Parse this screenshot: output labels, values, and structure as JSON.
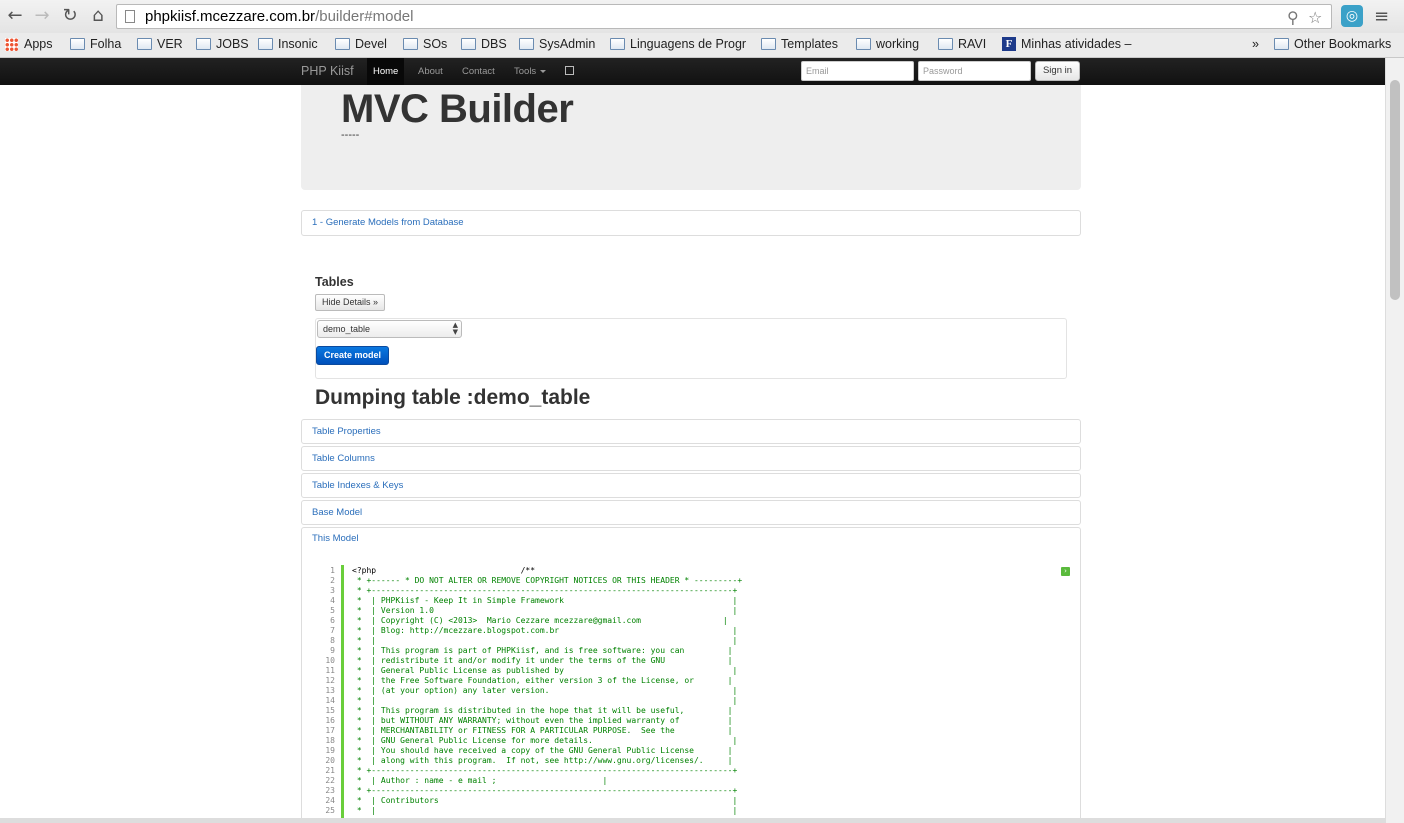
{
  "browser": {
    "url_host": "phpkiisf.mcezzare.com.br",
    "url_path": "/builder#model",
    "bookmarks": [
      {
        "label": "Apps",
        "type": "apps"
      },
      {
        "label": "Folha",
        "type": "folder"
      },
      {
        "label": "VER",
        "type": "folder"
      },
      {
        "label": "JOBS",
        "type": "folder"
      },
      {
        "label": "Insonic",
        "type": "folder"
      },
      {
        "label": "Devel",
        "type": "folder"
      },
      {
        "label": "SOs",
        "type": "folder"
      },
      {
        "label": "DBS",
        "type": "folder"
      },
      {
        "label": "SysAdmin",
        "type": "folder"
      },
      {
        "label": "Linguagens de Progr",
        "type": "folder"
      },
      {
        "label": "Templates",
        "type": "folder"
      },
      {
        "label": "working",
        "type": "folder"
      },
      {
        "label": "RAVI",
        "type": "folder"
      },
      {
        "label": "Minhas atividades –",
        "type": "f"
      }
    ],
    "overflow_label": "»",
    "other_bookmarks": "Other Bookmarks"
  },
  "navbar": {
    "brand": "PHP Kiisf",
    "links": [
      "Home",
      "About",
      "Contact",
      "Tools"
    ],
    "email_placeholder": "Email",
    "password_placeholder": "Password",
    "signin_label": "Sign in"
  },
  "hero": {
    "title": "MVC Builder",
    "subtitle": "-----"
  },
  "generate_link": "1 - Generate Models from Database",
  "tables": {
    "title": "Tables",
    "hide_details": "Hide Details »",
    "selected_table": "demo_table",
    "create_button": "Create model"
  },
  "dump_title": "Dumping table :demo_table",
  "sections": [
    "Table Properties",
    "Table Columns",
    "Table Indexes & Keys",
    "Base Model",
    "This Model"
  ],
  "code_lines": [
    "<?php                              /**",
    " * +------ * DO NOT ALTER OR REMOVE COPYRIGHT NOTICES OR THIS HEADER * ---------+",
    " * +---------------------------------------------------------------------------+",
    " *  | PHPKiisf - Keep It in Simple Framework                                   |",
    " *  | Version 1.0                                                              |",
    " *  | Copyright (C) <2013>  Mario Cezzare mcezzare@gmail.com                 |",
    " *  | Blog: http://mcezzare.blogspot.com.br                                    |",
    " *  |                                                                          |",
    " *  | This program is part of PHPKiisf, and is free software: you can         |",
    " *  | redistribute it and/or modify it under the terms of the GNU             |",
    " *  | General Public License as published by                                   |",
    " *  | the Free Software Foundation, either version 3 of the License, or       |",
    " *  | (at your option) any later version.                                      |",
    " *  |                                                                          |",
    " *  | This program is distributed in the hope that it will be useful,         |",
    " *  | but WITHOUT ANY WARRANTY; without even the implied warranty of          |",
    " *  | MERCHANTABILITY or FITNESS FOR A PARTICULAR PURPOSE.  See the           |",
    " *  | GNU General Public License for more details.                             |",
    " *  | You should have received a copy of the GNU General Public License       |",
    " *  | along with this program.  If not, see http://www.gnu.org/licenses/.     |",
    " * +---------------------------------------------------------------------------+",
    " *  | Author : name - e mail ;                      |",
    " * +---------------------------------------------------------------------------+",
    " *  | Contributors                                                             |",
    " *  |                                                                          |"
  ],
  "colors": {
    "link": "#2a6ebb",
    "primary_button": "#0050bb",
    "code_green": "#008200",
    "gutter": "#6ace3b"
  }
}
